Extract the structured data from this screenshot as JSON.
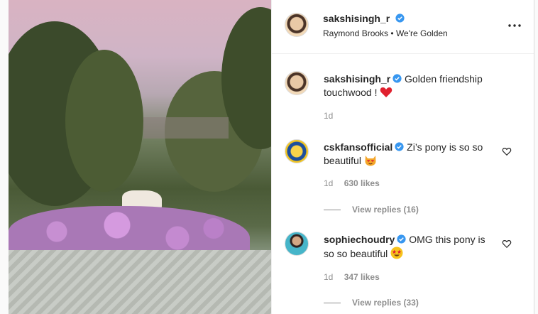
{
  "post": {
    "author": "sakshisingh_r",
    "audio": "Raymond Brooks",
    "separator": "•",
    "track": "We're Golden",
    "more_icon": "more-horizontal-icon",
    "verified_color": "#3897f0"
  },
  "comments": [
    {
      "username": "sakshisingh_r",
      "text": "Golden friendship touchwood !",
      "emoji": "red-heart",
      "time": "1d",
      "likes": "",
      "replies": ""
    },
    {
      "username": "cskfansofficial",
      "text": "Zi’s pony is so so beautiful",
      "emoji": "heart-eyes-cat",
      "time": "1d",
      "likes": "630 likes",
      "replies": "View replies (16)"
    },
    {
      "username": "sophiechoudry",
      "text": "OMG this pony is so so beautiful",
      "emoji": "star-struck",
      "time": "1d",
      "likes": "347 likes",
      "replies": "View replies (33)"
    }
  ]
}
